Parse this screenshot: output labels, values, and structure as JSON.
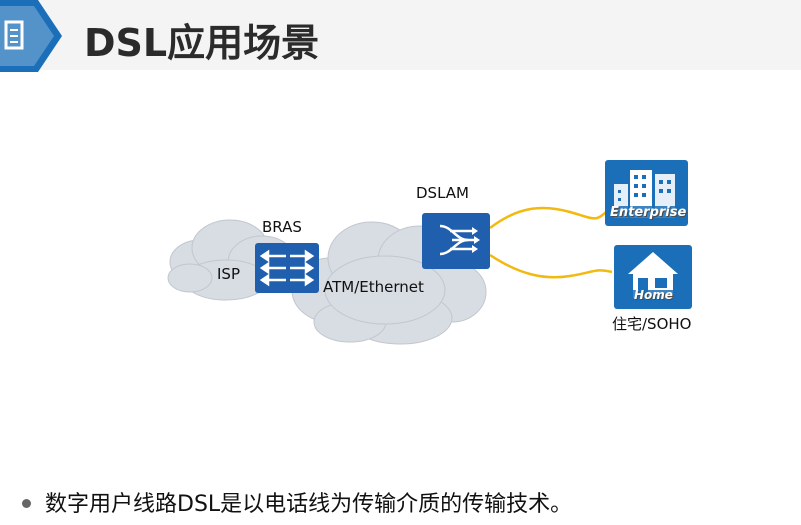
{
  "slide": {
    "title": "DSL应用场景",
    "bullet": "数字用户线路DSL是以电话线为传输介质的传输技术。"
  },
  "diagram": {
    "isp_label": "ISP",
    "bras_label": "BRAS",
    "atm_label": "ATM/Ethernet",
    "dslam_label": "DSLAM",
    "enterprise_label": "Enterprise",
    "home_label": "Home",
    "soho_label": "住宅/SOHO"
  },
  "colors": {
    "device_blue": "#1f5fae",
    "cloud_gray": "#d3d7de",
    "link_yellow": "#f2b90f",
    "accent_blue": "#1a6fb8"
  }
}
